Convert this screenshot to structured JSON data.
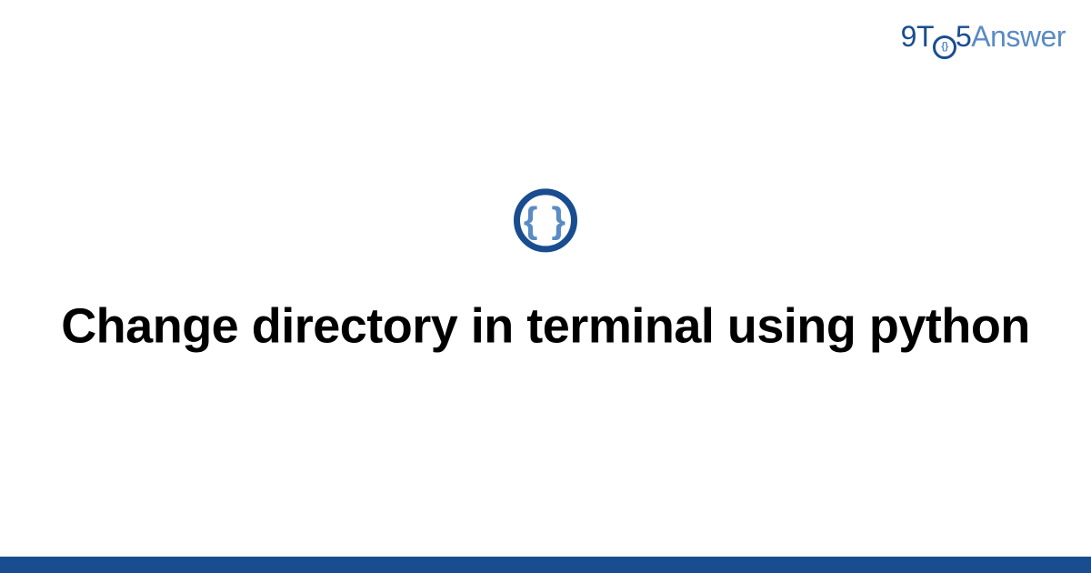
{
  "logo": {
    "part1": "9T",
    "part_o_inner": "{}",
    "part2": "5",
    "part3": "Answer"
  },
  "icon": {
    "braces": "{ }"
  },
  "title": "Change directory in terminal using python",
  "colors": {
    "primary": "#1a4d8f",
    "secondary": "#5a8bc4"
  }
}
